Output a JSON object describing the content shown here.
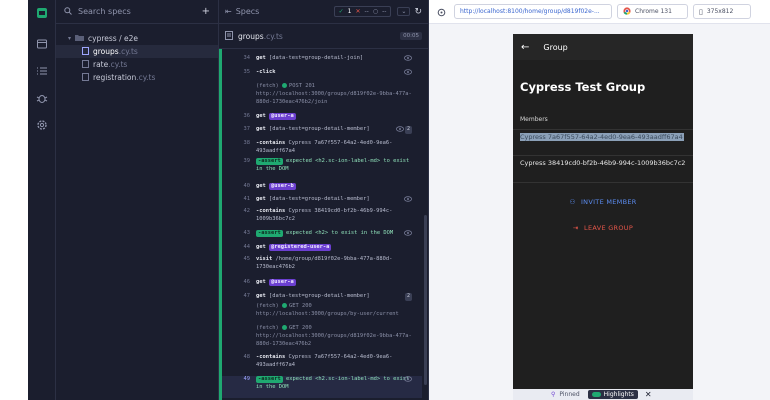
{
  "nav": {
    "icons": [
      "cypress-logo-icon",
      "specs-icon",
      "runs-icon",
      "debug-icon",
      "settings-icon"
    ]
  },
  "specs_panel": {
    "search_placeholder": "Search specs",
    "add_label": "+",
    "folder": "cypress / e2e",
    "files": [
      {
        "name": "groups",
        "ext": ".cy.ts",
        "active": true
      },
      {
        "name": "rate",
        "ext": ".cy.ts",
        "active": false
      },
      {
        "name": "registration",
        "ext": ".cy.ts",
        "active": false
      }
    ]
  },
  "reporter": {
    "header_label": "Specs",
    "passed": "1",
    "failed": "--",
    "pending": "--",
    "file_name": "groups",
    "file_ext": ".cy.ts",
    "duration": "00:05",
    "entries": [
      {
        "n": "34",
        "cmd": "get",
        "text": "[data-test=group-detail-join]",
        "eye": true
      },
      {
        "n": "35",
        "cmd": "-click",
        "text": "",
        "eye": true
      },
      {
        "n": "",
        "cmd": "(fetch)",
        "text": "POST 201 http://localhost:3000/groups/d819f02e-9bba-477a-880d-1730eac476b2/join",
        "dot": true
      },
      {
        "n": "36",
        "cmd": "get",
        "alias": "@user-a"
      },
      {
        "n": "37",
        "cmd": "get",
        "text": "[data-test=group-detail-member]",
        "eye": true,
        "badge": "2"
      },
      {
        "n": "38",
        "cmd": "-contains",
        "text": "Cypress 7a67f557-64a2-4ed0-9ea6-493aadff67a4"
      },
      {
        "n": "39",
        "cmd": "-assert",
        "text": "expected <h2.sc-ion-label-md> to exist in the DOM",
        "assert": true
      },
      {
        "n": "40",
        "cmd": "get",
        "alias": "@user-b"
      },
      {
        "n": "41",
        "cmd": "get",
        "text": "[data-test=group-detail-member]",
        "eye": true
      },
      {
        "n": "42",
        "cmd": "-contains",
        "text": "Cypress 38419cd0-bf2b-46b9-994c-1009b36bc7c2"
      },
      {
        "n": "43",
        "cmd": "-assert",
        "text": "expected <h2> to exist in the DOM",
        "assert": true,
        "eye": true
      },
      {
        "n": "44",
        "cmd": "get",
        "alias": "@registered-user-a"
      },
      {
        "n": "45",
        "cmd": "visit",
        "text": "/home/group/d819f02e-9bba-477a-880d-1730eac476b2"
      },
      {
        "n": "46",
        "cmd": "get",
        "alias": "@user-a"
      },
      {
        "n": "47",
        "cmd": "get",
        "text": "[data-test=group-detail-member]",
        "badge": "2"
      },
      {
        "n": "",
        "cmd": "(fetch)",
        "text": "GET 200 http://localhost:3000/groups/by-user/current",
        "dot": true
      },
      {
        "n": "",
        "cmd": "(fetch)",
        "text": "GET 200 http://localhost:3000/groups/d819f02e-9bba-477a-880d-1730eac476b2",
        "dot": true
      },
      {
        "n": "48",
        "cmd": "-contains",
        "text": "Cypress 7a67f557-64a2-4ed0-9ea6-493aadff67a4"
      },
      {
        "n": "49",
        "cmd": "-assert",
        "text": "expected <h2.sc-ion-label-md> to exist in the DOM",
        "assert": true,
        "eye": true,
        "pinned": true
      }
    ]
  },
  "browser": {
    "url": "http://localhost:8100/home/group/d819f02e-...",
    "browser_name": "Chrome 131",
    "viewport": "375x812",
    "app": {
      "toolbar_title": "Group",
      "group_title": "Cypress Test Group",
      "members_label": "Members",
      "members": [
        "Cypress 7a67f557-64a2-4ed0-9ea6-493aadff67a4",
        "Cypress 38419cd0-bf2b-46b9-994c-1009b36bc7c2"
      ],
      "invite_label": "INVITE MEMBER",
      "leave_label": "LEAVE GROUP"
    },
    "footer": {
      "pinned": "Pinned",
      "highlights": "Highlights"
    }
  },
  "colors": {
    "accent_green": "#1fa971",
    "alias_purple": "#6b3fd0",
    "invite_blue": "#5b8cf0",
    "leave_red": "#e5564a"
  }
}
